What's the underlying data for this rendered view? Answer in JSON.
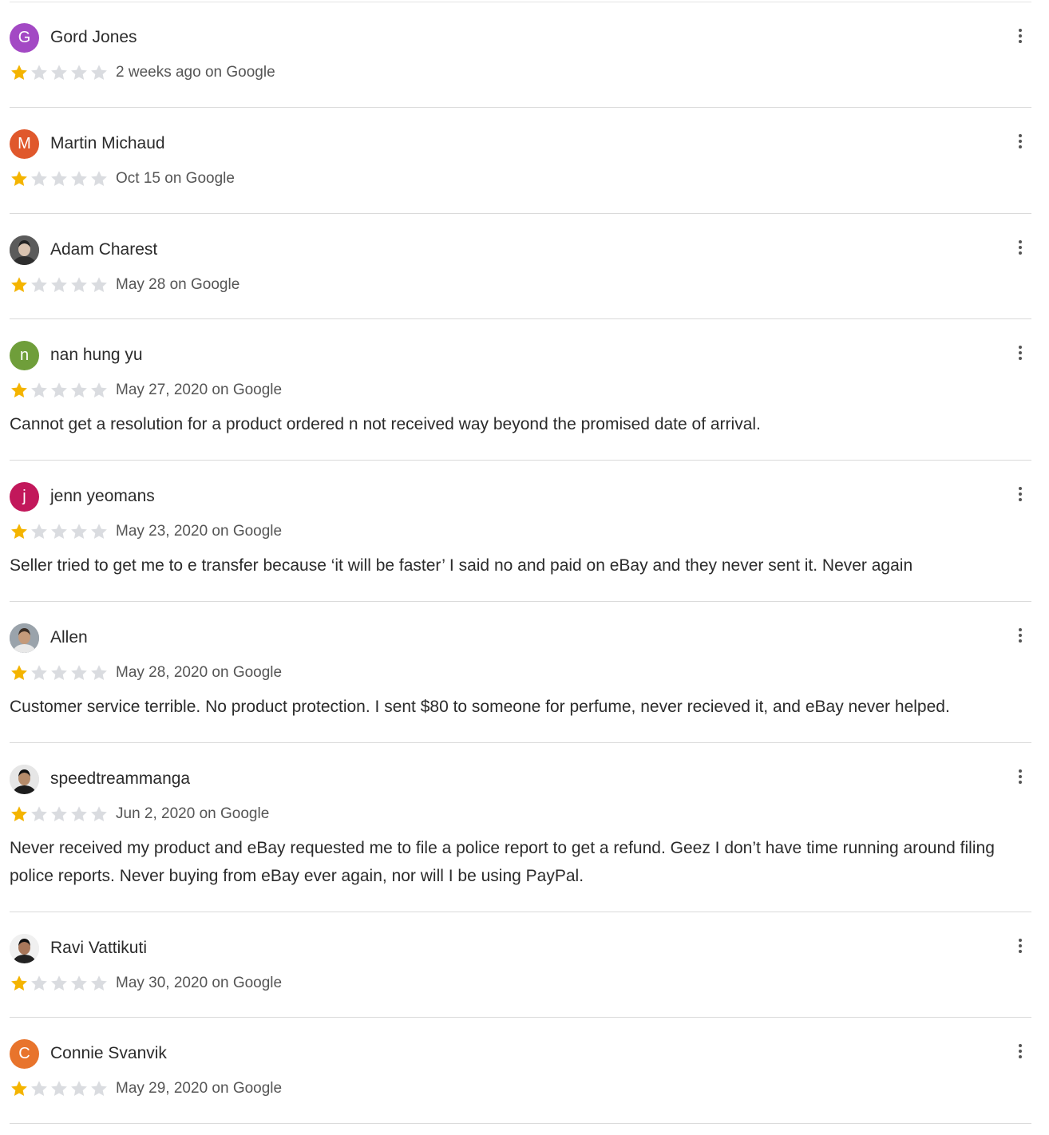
{
  "reviews": [
    {
      "name": "Gord Jones",
      "initial": "G",
      "avatar_color": "#a349c4",
      "rating": 1,
      "date": "2 weeks ago on Google",
      "text": ""
    },
    {
      "name": "Martin Michaud",
      "initial": "M",
      "avatar_color": "#e0582c",
      "rating": 1,
      "date": "Oct 15 on Google",
      "text": ""
    },
    {
      "name": "Adam Charest",
      "initial": "",
      "avatar_color": "#4a4a4a",
      "avatar_icon": "profile-photo",
      "rating": 1,
      "date": "May 28 on Google",
      "text": ""
    },
    {
      "name": "nan hung yu",
      "initial": "n",
      "avatar_color": "#6f9e3a",
      "rating": 1,
      "date": "May 27, 2020 on Google",
      "text": "Cannot get a resolution for a product ordered n not received way beyond the promised date of arrival."
    },
    {
      "name": "jenn yeomans",
      "initial": "j",
      "avatar_color": "#c2185b",
      "rating": 1,
      "date": "May 23, 2020 on Google",
      "text": "Seller tried to get me to e transfer because ‘it will be faster’ I said no and paid on eBay and they never sent it. Never again"
    },
    {
      "name": "Allen",
      "initial": "",
      "avatar_color": "#8a8f95",
      "avatar_icon": "profile-photo",
      "rating": 1,
      "date": "May 28, 2020 on Google",
      "text": "Customer service terrible. No product protection. I sent $80 to someone for perfume, never recieved it, and eBay never helped."
    },
    {
      "name": "speedtreammanga",
      "initial": "",
      "avatar_color": "#d9d9d9",
      "avatar_icon": "profile-photo",
      "rating": 1,
      "date": "Jun 2, 2020 on Google",
      "text": "Never received my product and eBay requested me to file a police report to get a refund. Geez I don’t have time running around filing police reports. Never buying from eBay ever again, nor will I be using PayPal."
    },
    {
      "name": "Ravi Vattikuti",
      "initial": "",
      "avatar_color": "#e8e8e8",
      "avatar_icon": "profile-photo",
      "rating": 1,
      "date": "May 30, 2020 on Google",
      "text": ""
    },
    {
      "name": "Connie Svanvik",
      "initial": "C",
      "avatar_color": "#e8742c",
      "rating": 1,
      "date": "May 29, 2020 on Google",
      "text": ""
    }
  ],
  "colors": {
    "star_filled": "#f4b400",
    "star_empty": "#dadce0"
  }
}
